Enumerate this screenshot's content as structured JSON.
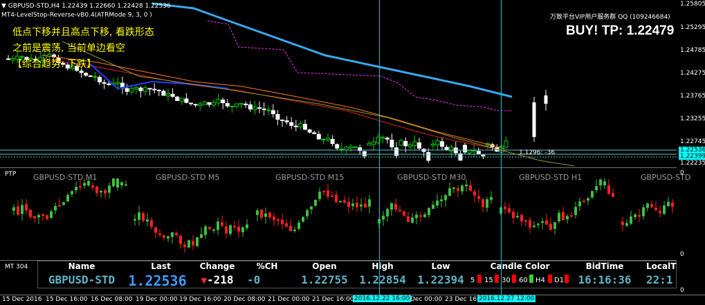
{
  "main_chart": {
    "header": "GBPUSD-STD,H4  1.22439 1.22660 1.22428 1.22536",
    "indicator_label": "MT4-LevelStop-Reverse-vB0.4(ATRMode 9, 3, 0 )",
    "watermark": "万致平台VIP用户服务群 QQ (109246684)",
    "signal": "BUY!  TP: 1.22479",
    "comment_lines": [
      "低点下移并且高点下移, 看跌形态",
      "之前是震荡, 当前单边看空",
      "【综合趋势: 下跌】"
    ],
    "level_label": "1.1296: -36",
    "price_axis": [
      "1.25805",
      "1.25295",
      "1.24785",
      "1.24275",
      "1.23765",
      "1.23255",
      "1.22745"
    ],
    "highlight_prices": [
      "1.22536",
      "1.22399",
      "1.22235"
    ],
    "colors": {
      "background": "#000000",
      "ma_blue": "#39a9f0",
      "line_magenta": "#ff2fff",
      "accent_cyan": "#00e5ff"
    }
  },
  "ptp_panel": {
    "label": "PTP",
    "timeframes": [
      "GBPUSD-STD M1",
      "GBPUSD-STD M5",
      "GBPUSD-STD M15",
      "GBPUSD-STD M30",
      "GBPUSD-STD H1",
      "GBPUSD-STD"
    ],
    "axis_top": "0",
    "axis_bottom": "0"
  },
  "mt_table": {
    "label": "MT 304",
    "headers": [
      "Name",
      "Last",
      "Change",
      "%CH",
      "Open",
      "High",
      "Low",
      "Candle Color",
      "BidTime",
      "LocalT"
    ],
    "row": {
      "name": "GBPUSD-STD",
      "last": "1.22536",
      "change": "-218",
      "pch": "-0",
      "open": "1.22755",
      "high": "1.22854",
      "low": "1.22394",
      "bidtime": "16:16:36",
      "localt": "22:1"
    },
    "candle_tfs": [
      "5",
      "15",
      "30",
      "60",
      "H4",
      "D1"
    ],
    "axis_bottom": "0"
  },
  "time_axis": {
    "labels": [
      "15 Dec 2016",
      "15 Dec 16:00",
      "16 Dec 08:00",
      "19 Dec 00:00",
      "19 Dec 16:00",
      "20 Dec 08:00",
      "21 Dec 00:00",
      "21 Dec 16:00",
      "",
      "Dec 00:00",
      "23 Dec 16"
    ],
    "highlights": [
      "2016.12.22 16:00",
      "2016.12.27 12:00"
    ]
  }
}
